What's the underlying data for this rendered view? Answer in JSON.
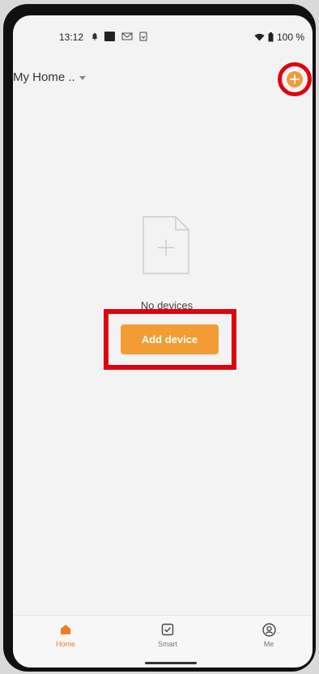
{
  "status_bar": {
    "time": "13:12",
    "battery": "100 %"
  },
  "header": {
    "home_name": "My Home ..",
    "add_icon": "plus-circle-icon"
  },
  "empty_state": {
    "message": "No devices",
    "button_label": "Add device"
  },
  "bottom_nav": {
    "items": [
      {
        "label": "Home",
        "icon": "home-icon",
        "active": true
      },
      {
        "label": "Smart",
        "icon": "smart-icon",
        "active": false
      },
      {
        "label": "Me",
        "icon": "profile-icon",
        "active": false
      }
    ]
  },
  "colors": {
    "accent": "#f39c34",
    "highlight_red": "#e00010",
    "background": "#f3f3f3"
  }
}
